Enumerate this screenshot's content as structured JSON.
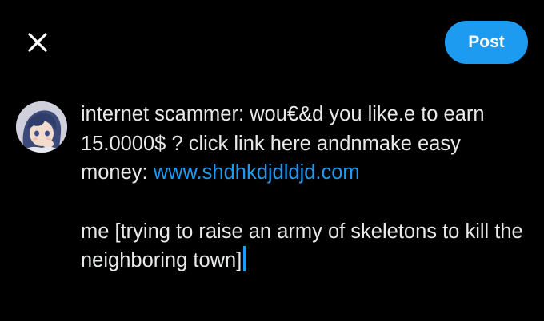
{
  "toolbar": {
    "close_icon": "close-icon",
    "post_label": "Post"
  },
  "colors": {
    "accent": "#1d9bf0",
    "background": "#000000",
    "text": "#e7e9ea"
  },
  "composer": {
    "line1_text": "internet scammer: wou€&d you like.e to earn 15.0000$ ? click link here andnmake easy money: ",
    "link_text": "www.shdhkdjdldjd.com",
    "line2_text": "me [trying to raise an army of skeletons to kill the neighboring town]"
  },
  "avatar": {
    "icon": "avatar"
  }
}
